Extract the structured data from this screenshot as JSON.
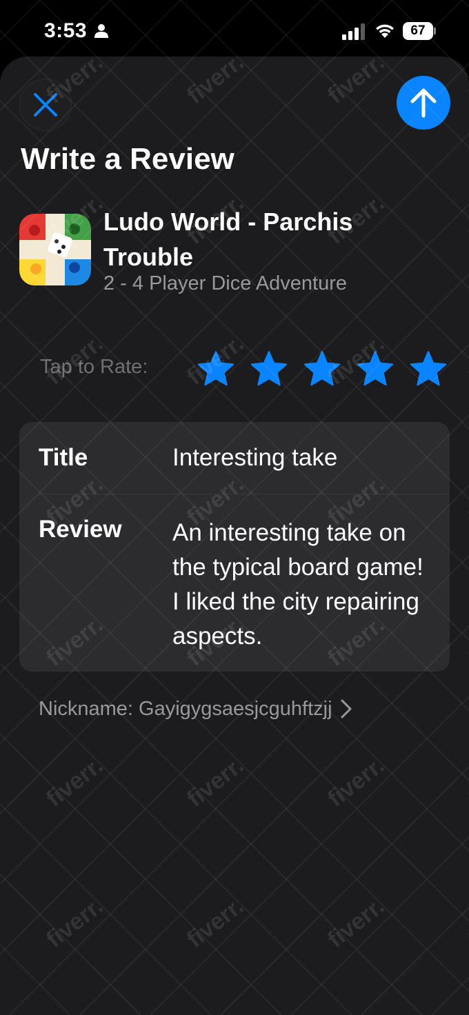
{
  "status_bar": {
    "time": "3:53",
    "battery_level": "67"
  },
  "sheet": {
    "title": "Write a Review"
  },
  "app": {
    "name": "Ludo World - Parchis Trouble",
    "subtitle": "2 - 4 Player Dice Adventure"
  },
  "rating": {
    "label": "Tap to Rate:",
    "value": 5,
    "max": 5,
    "star_color": "#0a84ff"
  },
  "form": {
    "title_label": "Title",
    "title_value": "Interesting take",
    "review_label": "Review",
    "review_value": "An interesting take on the typical board game! I liked the city repairing aspects."
  },
  "nickname": {
    "text": "Nickname: Gayigygsaesjcguhftzjj"
  },
  "watermark": {
    "text": "fiverr."
  },
  "colors": {
    "accent": "#0a84ff",
    "sheet_background": "#1c1c1e",
    "card_background": "#2c2c2e"
  }
}
